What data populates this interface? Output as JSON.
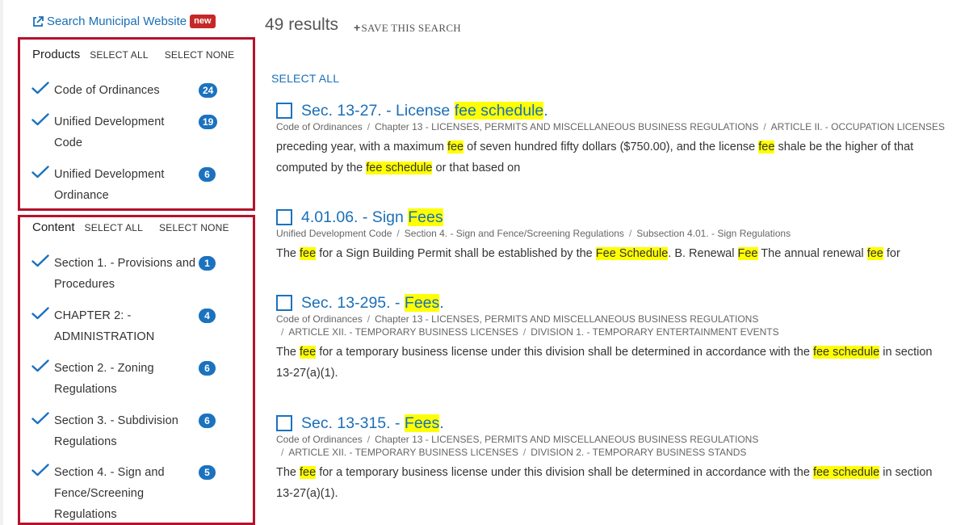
{
  "header": {
    "search_site_label": "Search Municipal Website",
    "new_badge": "new",
    "results_count": "49 results",
    "save_search_label": "SAVE THIS SEARCH"
  },
  "facets": {
    "products": {
      "title": "Products",
      "select_all": "SELECT ALL",
      "select_none": "SELECT NONE",
      "items": [
        {
          "line1": "Code of Ordinances",
          "line2": "",
          "count": "24",
          "checked": true
        },
        {
          "line1": "Unified Development",
          "line2": "Code",
          "count": "19",
          "checked": true
        },
        {
          "line1": "Unified Development",
          "line2": "Ordinance",
          "count": "6",
          "checked": true
        }
      ]
    },
    "content": {
      "title": "Content",
      "select_all": "SELECT ALL",
      "select_none": "SELECT NONE",
      "items": [
        {
          "line1": "Section 1. - Provisions and",
          "line2": "Procedures",
          "count": "1",
          "checked": true
        },
        {
          "line1": "CHAPTER 2: -",
          "line2": "ADMINISTRATION",
          "count": "4",
          "checked": true
        },
        {
          "line1": "Section 2. - Zoning",
          "line2": "Regulations",
          "count": "6",
          "checked": true
        },
        {
          "line1": "Section 3. - Subdivision",
          "line2": "Regulations",
          "count": "6",
          "checked": true
        },
        {
          "line1": "Section 4. - Sign and",
          "line2": "Fence/Screening",
          "line3": "Regulations",
          "count": "5",
          "checked": true
        }
      ]
    }
  },
  "results": {
    "select_all": "SELECT ALL",
    "items": [
      {
        "title_pre": "Sec. 13-27. - License ",
        "title_hl": "fee schedule",
        "title_post": ".",
        "crumbs": [
          "Code of Ordinances",
          "Chapter 13 - LICENSES, PERMITS AND MISCELLANEOUS BUSINESS REGULATIONS",
          "ARTICLE II. - OCCUPATION LICENSES"
        ],
        "snippet": [
          {
            "t": "preceding year, with a maximum "
          },
          {
            "t": "fee",
            "hl": true
          },
          {
            "t": " of seven hundred fifty dollars ($750.00), and the license "
          },
          {
            "t": "fee",
            "hl": true
          },
          {
            "t": " shale be the higher of that"
          },
          {
            "t": "computed by the ",
            "br": true
          },
          {
            "t": "fee schedule",
            "hl": true
          },
          {
            "t": " or that based on"
          }
        ]
      },
      {
        "title_pre": "4.01.06. - Sign ",
        "title_hl": "Fees",
        "title_post": "",
        "crumbs": [
          "Unified Development Code",
          "Section 4. - Sign and Fence/Screening Regulations",
          "Subsection 4.01. - Sign Regulations"
        ],
        "snippet": [
          {
            "t": "The "
          },
          {
            "t": "fee",
            "hl": true
          },
          {
            "t": " for a Sign Building Permit shall be established by the "
          },
          {
            "t": "Fee Schedule",
            "hl": true
          },
          {
            "t": ". B. Renewal "
          },
          {
            "t": "Fee",
            "hl": true
          },
          {
            "t": " The annual renewal "
          },
          {
            "t": "fee",
            "hl": true
          },
          {
            "t": " for"
          }
        ]
      },
      {
        "title_pre": "Sec. 13-295. - ",
        "title_hl": "Fees",
        "title_post": ".",
        "crumbs": [
          "Code of Ordinances",
          "Chapter 13 - LICENSES, PERMITS AND MISCELLANEOUS BUSINESS REGULATIONS"
        ],
        "crumbs2": [
          "ARTICLE XII. - TEMPORARY BUSINESS LICENSES",
          "DIVISION 1. - TEMPORARY ENTERTAINMENT EVENTS"
        ],
        "snippet": [
          {
            "t": "The "
          },
          {
            "t": "fee",
            "hl": true
          },
          {
            "t": " for a temporary business license under this division shall be determined in accordance with the "
          },
          {
            "t": "fee schedule",
            "hl": true
          },
          {
            "t": " in section"
          },
          {
            "t": "13-27(a)(1).",
            "br": true
          }
        ]
      },
      {
        "title_pre": "Sec. 13-315. - ",
        "title_hl": "Fees",
        "title_post": ".",
        "crumbs": [
          "Code of Ordinances",
          "Chapter 13 - LICENSES, PERMITS AND MISCELLANEOUS BUSINESS REGULATIONS"
        ],
        "crumbs2": [
          "ARTICLE XII. - TEMPORARY BUSINESS LICENSES",
          "DIVISION 2. - TEMPORARY BUSINESS STANDS"
        ],
        "snippet": [
          {
            "t": "The "
          },
          {
            "t": "fee",
            "hl": true
          },
          {
            "t": " for a temporary business license under this division shall be determined in accordance with the "
          },
          {
            "t": "fee schedule",
            "hl": true
          },
          {
            "t": " in section"
          },
          {
            "t": "13-27(a)(1).",
            "br": true
          }
        ]
      }
    ]
  }
}
